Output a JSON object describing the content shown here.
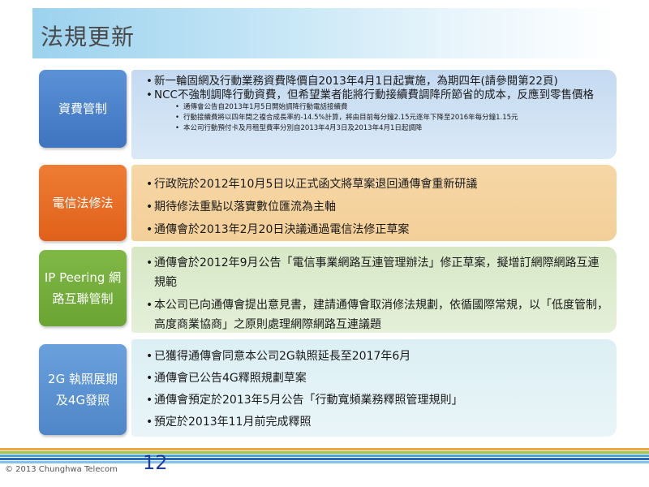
{
  "title": "法規更新",
  "sections": [
    {
      "label": "資費管制",
      "bullets": [
        "新一輪固網及行動業務資費降價自2013年4月1日起實施，為期四年(請參閱第22頁)",
        "NCC不強制調降行動資費，但希望業者能將行動接續費調降所節省的成本，反應到零售價格"
      ],
      "sub_bullets": [
        "通傳會公告自2013年1月5日開始調降行動電話接續費",
        "行動接續費將以四年間之複合成長率約-14.5%計算，將由目前每分鐘2.15元逐年下降至2016年每分鐘1.15元",
        "本公司行動預付卡及月租型費率分別自2013年4月3日及2013年4月1日起調降"
      ]
    },
    {
      "label": "電信法修法",
      "bullets": [
        "行政院於2012年10月5日以正式函文將草案退回通傳會重新研議",
        "期待修法重點以落實數位匯流為主軸",
        "通傳會於2013年2月20日決議通過電信法修正草案"
      ]
    },
    {
      "label_line1": "IP Peering 網",
      "label_line2": "路互聯管制",
      "bullets": [
        "通傳會於2012年9月公告「電信事業網路互連管理辦法」修正草案，擬增訂網際網路互連規範",
        "本公司已向通傳會提出意見書，建請通傳會取消修法規劃，依循國際常規，以「低度管制，高度商業協商」之原則處理網際網路互連議題"
      ]
    },
    {
      "label_line1": "2G 執照展期",
      "label_line2": "及4G發照",
      "bullets": [
        "已獲得通傳會同意本公司2G執照延長至2017年6月",
        "通傳會已公告4G釋照規劃草案",
        "通傳會預定於2013年5月公告「行動寬頻業務釋照管理規則」",
        "預定於2013年11月前完成釋照"
      ]
    }
  ],
  "footer": {
    "copyright": "© 2013 Chunghwa Telecom",
    "page_number": "12"
  },
  "colors": {
    "row1_label": "#4a82cc",
    "row2_label": "#e8702a",
    "row3_label": "#76af3c",
    "row4_label": "#5d93d2"
  }
}
